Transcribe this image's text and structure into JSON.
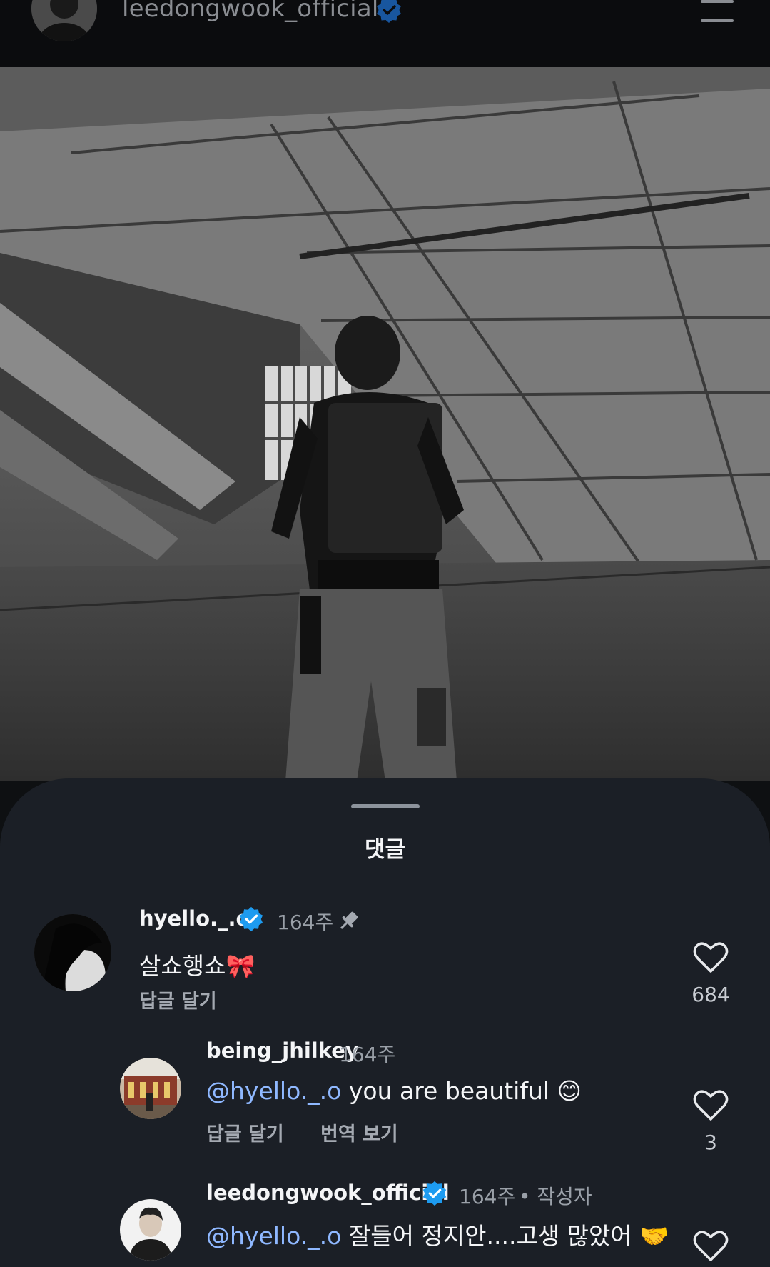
{
  "header": {
    "username": "leedongwook_official",
    "avatar_icon": "profile-avatar",
    "verified_icon": "verified-badge-icon",
    "menu_icon": "hamburger-menu-icon"
  },
  "post": {
    "image_description_icon": "post-photo"
  },
  "comments_sheet": {
    "title": "댓글",
    "comments": [
      {
        "username": "hyello._.o",
        "verified": true,
        "time": "164주",
        "pinned": true,
        "text": "살쇼행쇼🎀",
        "reply_label": "답글 달기",
        "like_count": "684"
      },
      {
        "username": "being_jhilkey",
        "verified": false,
        "time": "164주",
        "mention": "@hyello._.o",
        "text": " you are beautiful 😊",
        "reply_label": "답글 달기",
        "translate_label": "번역 보기",
        "like_count": "3"
      },
      {
        "username": "leedongwook_official",
        "verified": true,
        "time": "164주",
        "author_badge": "• 작성자",
        "mention": "@hyello._.o",
        "text": " 잘들어 정지안....고생 많았어 🤝"
      }
    ]
  },
  "colors": {
    "background": "#0e1012",
    "sheet": "#1b1f26",
    "mention": "#8fb8ff",
    "verified": "#1d9bf0"
  }
}
